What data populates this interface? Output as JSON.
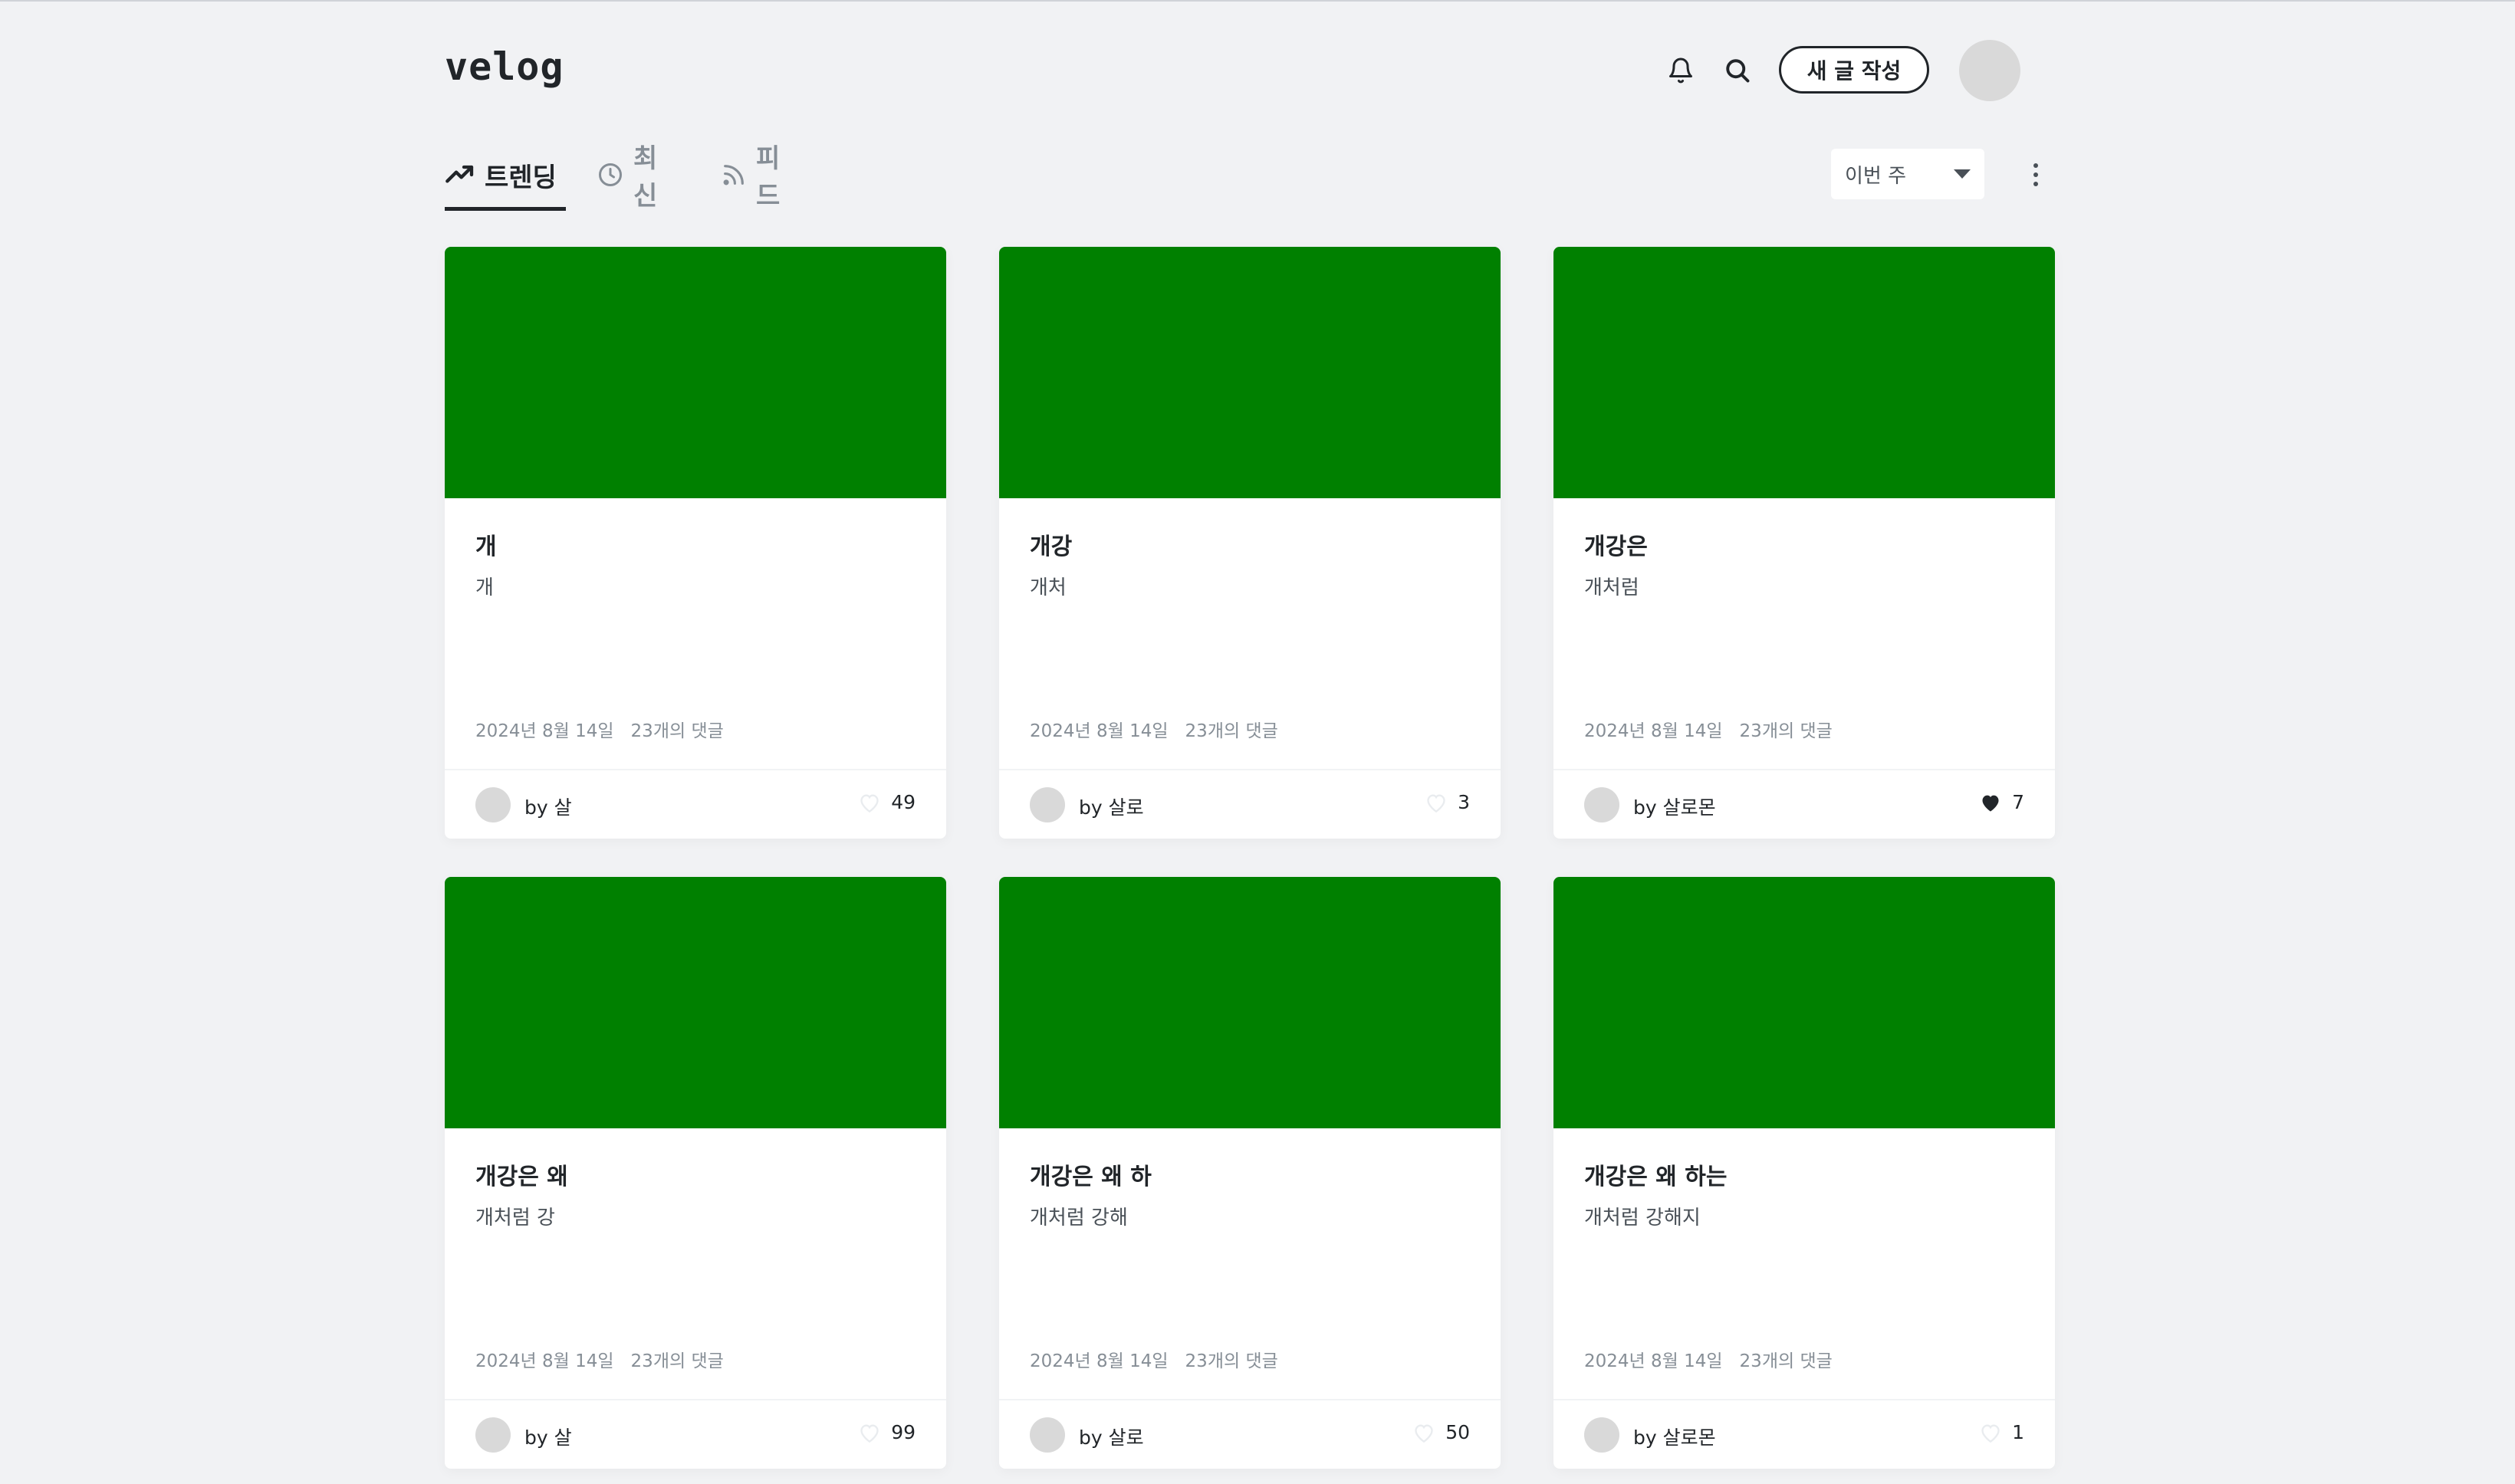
{
  "header": {
    "logo": "velog",
    "write_label": "새 글 작성"
  },
  "tabs": [
    {
      "label": "트렌딩",
      "icon": "trending-icon",
      "active": true
    },
    {
      "label": "최신",
      "icon": "clock-icon",
      "active": false
    },
    {
      "label": "피드",
      "icon": "rss-icon",
      "active": false
    }
  ],
  "period": {
    "label": "이번 주"
  },
  "colors": {
    "thumbnail": "#008000",
    "background": "#f1f2f4",
    "text": "#212529",
    "muted": "#868e96"
  },
  "posts": [
    {
      "title": "개",
      "desc": "개",
      "date": "2024년 8월 14일",
      "comments": "23개의 댓글",
      "author": "by 살",
      "likes": "49",
      "liked": false
    },
    {
      "title": "개강",
      "desc": "개처",
      "date": "2024년 8월 14일",
      "comments": "23개의 댓글",
      "author": "by 살로",
      "likes": "3",
      "liked": false
    },
    {
      "title": "개강은",
      "desc": "개처럼",
      "date": "2024년 8월 14일",
      "comments": "23개의 댓글",
      "author": "by 살로몬",
      "likes": "7",
      "liked": true
    },
    {
      "title": "개강은 왜",
      "desc": "개처럼 강",
      "date": "2024년 8월 14일",
      "comments": "23개의 댓글",
      "author": "by 살",
      "likes": "99",
      "liked": false
    },
    {
      "title": "개강은 왜 하",
      "desc": "개처럼 강해",
      "date": "2024년 8월 14일",
      "comments": "23개의 댓글",
      "author": "by 살로",
      "likes": "50",
      "liked": false
    },
    {
      "title": "개강은 왜 하는",
      "desc": "개처럼 강해지",
      "date": "2024년 8월 14일",
      "comments": "23개의 댓글",
      "author": "by 살로몬",
      "likes": "1",
      "liked": false
    }
  ]
}
